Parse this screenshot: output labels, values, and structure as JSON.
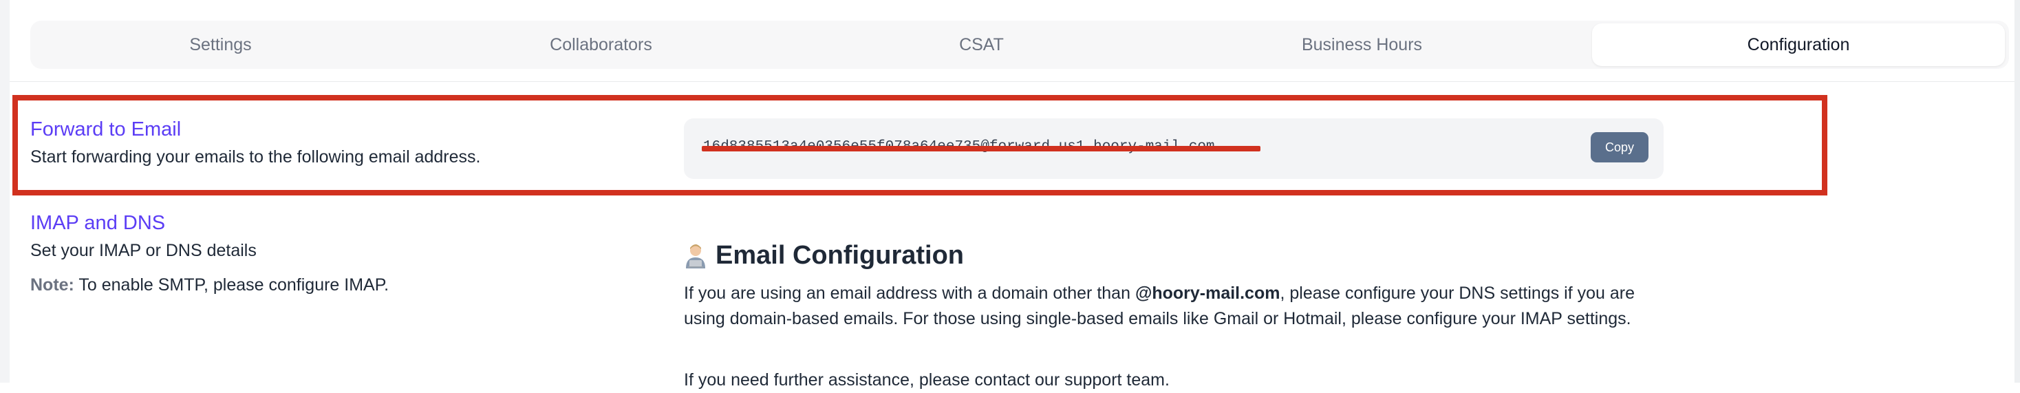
{
  "tabs": [
    {
      "label": "Settings"
    },
    {
      "label": "Collaborators"
    },
    {
      "label": "CSAT"
    },
    {
      "label": "Business Hours"
    },
    {
      "label": "Configuration"
    }
  ],
  "active_tab": "Configuration",
  "forward": {
    "title": "Forward to Email",
    "description": "Start forwarding your emails to the following email address.",
    "email": "16d8385513a4e0356e55f078a64ee735@forward.us1.hoory-mail.com",
    "copy_label": "Copy"
  },
  "imap": {
    "title": "IMAP and DNS",
    "description": "Set your IMAP or DNS details",
    "note_label": "Note:",
    "note_text": " To enable SMTP, please configure IMAP."
  },
  "email_config": {
    "heading": "Email Configuration",
    "icon": "person-technologist-icon",
    "para1_before": "If you are using an email address with a domain other than ",
    "para1_domain": "@hoory-mail.com",
    "para1_after": ", please configure your DNS settings if you are using domain-based emails. For those using single-based emails like Gmail or Hotmail, please configure your IMAP settings.",
    "para2": "If you need further assistance, please contact our support team."
  },
  "colors": {
    "accent": "#5b3df5",
    "highlight": "#d1311f",
    "copy_button": "#5a6f8c"
  }
}
